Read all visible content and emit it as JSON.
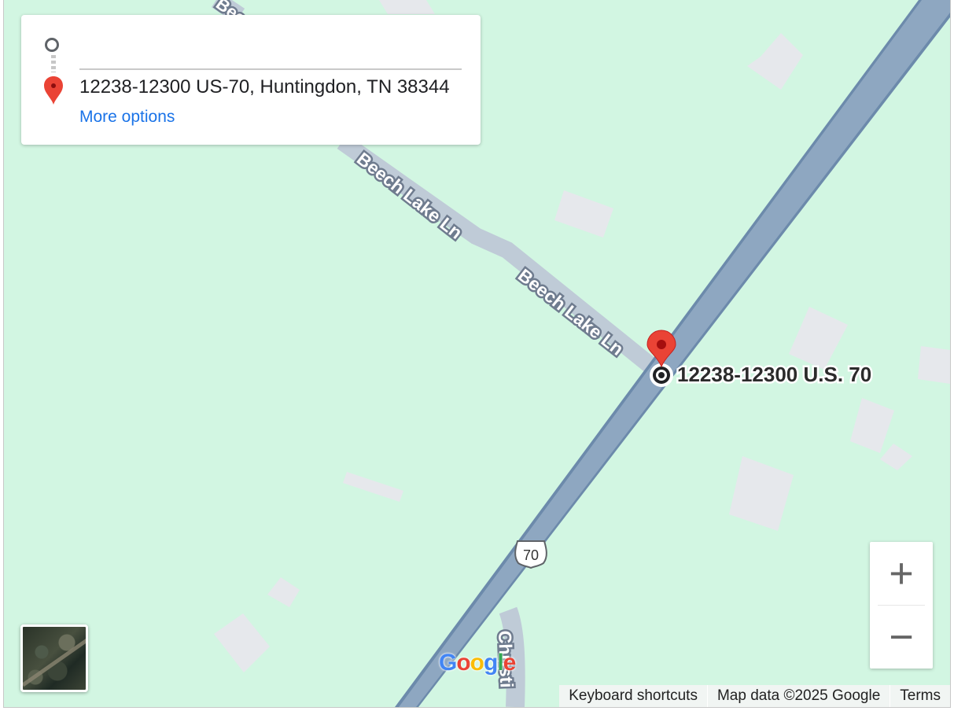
{
  "directions": {
    "origin_value": "",
    "destination_value": "12238-12300 US-70, Huntingdon, TN 38344",
    "more_options": "More options"
  },
  "map": {
    "pin_label": "12238-12300 U.S. 70",
    "road_labels": {
      "beech_upper": "Beech Lake Ln",
      "beech_lower": "Beech Lake Ln",
      "christi": "Christi",
      "top_edge": "Beech Lake Ln"
    },
    "route_shield": "70",
    "colors": {
      "land": "#d2f6e2",
      "highway": "#8ea7c1",
      "local_road": "#bfcbd7",
      "building": "#e6e8ec",
      "pin": "#ea4335"
    }
  },
  "controls": {
    "zoom_in": "+",
    "zoom_out": "−"
  },
  "branding": {
    "logo": "Google"
  },
  "footer": {
    "keyboard": "Keyboard shortcuts",
    "map_data": "Map data ©2025 Google",
    "terms": "Terms"
  }
}
